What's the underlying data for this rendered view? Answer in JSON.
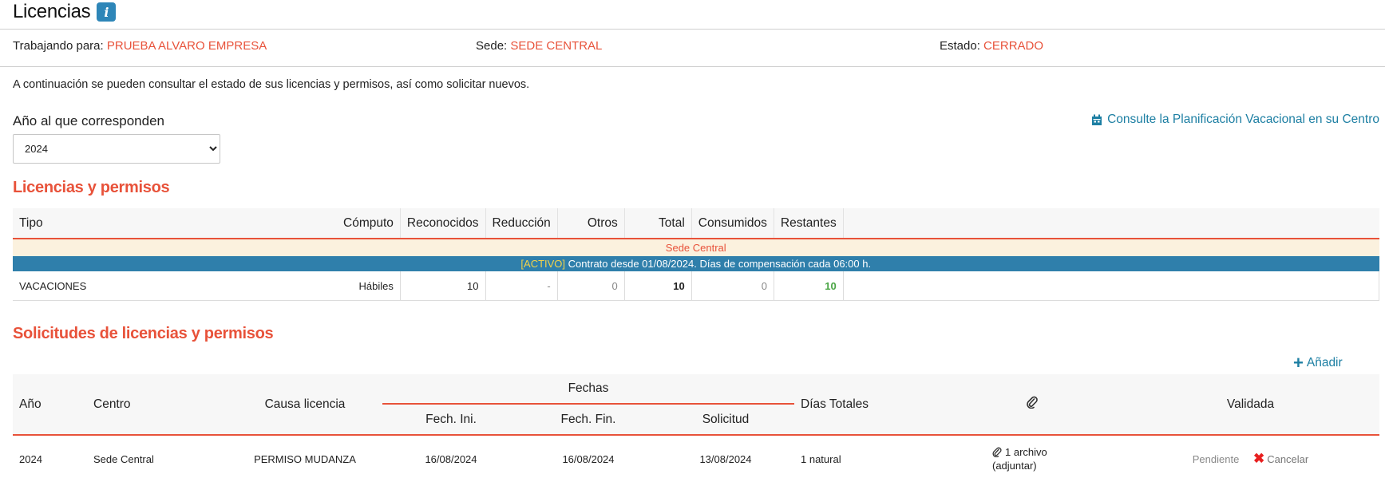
{
  "page": {
    "title": "Licencias",
    "info_icon": "i"
  },
  "context": {
    "working_for_label": "Trabajando para:",
    "working_for_value": "PRUEBA ALVARO EMPRESA",
    "sede_label": "Sede:",
    "sede_value": "SEDE CENTRAL",
    "estado_label": "Estado:",
    "estado_value": "CERRADO"
  },
  "intro_text": "A continuación se pueden consultar el estado de sus licencias y permisos, así como solicitar nuevos.",
  "year_filter": {
    "label": "Año al que corresponden",
    "selected": "2024"
  },
  "planning_link": {
    "icon": "calendar-icon",
    "label": "Consulte la Planificación Vacacional en su Centro"
  },
  "licenses": {
    "title": "Licencias y permisos",
    "columns": [
      "Tipo",
      "Cómputo",
      "Reconocidos",
      "Reducción",
      "Otros",
      "Total",
      "Consumidos",
      "Restantes"
    ],
    "group_label": "Sede Central",
    "contract_badge": "[ACTIVO]",
    "contract_text": "Contrato desde 01/08/2024. Días de compensación cada 06:00 h.",
    "rows": [
      {
        "tipo": "VACACIONES",
        "computo": "Hábiles",
        "reconocidos": "10",
        "reduccion": "-",
        "otros": "0",
        "total": "10",
        "consumidos": "0",
        "restantes": "10"
      }
    ]
  },
  "requests": {
    "title": "Solicitudes de licencias y permisos",
    "add_label": "Añadir",
    "columns": {
      "anio": "Año",
      "centro": "Centro",
      "causa": "Causa licencia",
      "fechas": "Fechas",
      "fech_ini": "Fech. Ini.",
      "fech_fin": "Fech. Fin.",
      "solicitud": "Solicitud",
      "dias": "Días Totales",
      "validada": "Validada"
    },
    "rows": [
      {
        "anio": "2024",
        "centro": "Sede Central",
        "causa": "PERMISO MUDANZA",
        "fech_ini": "16/08/2024",
        "fech_fin": "16/08/2024",
        "solicitud": "13/08/2024",
        "dias": "1 natural",
        "attachment": "1 archivo",
        "attach_action": "(adjuntar)",
        "status": "Pendiente",
        "cancel": "Cancelar"
      }
    ]
  },
  "colors": {
    "accent_red": "#e8523a",
    "link_blue": "#1d7fa3",
    "contract_blue": "#2f7fab",
    "ok_green": "#4aa545"
  }
}
